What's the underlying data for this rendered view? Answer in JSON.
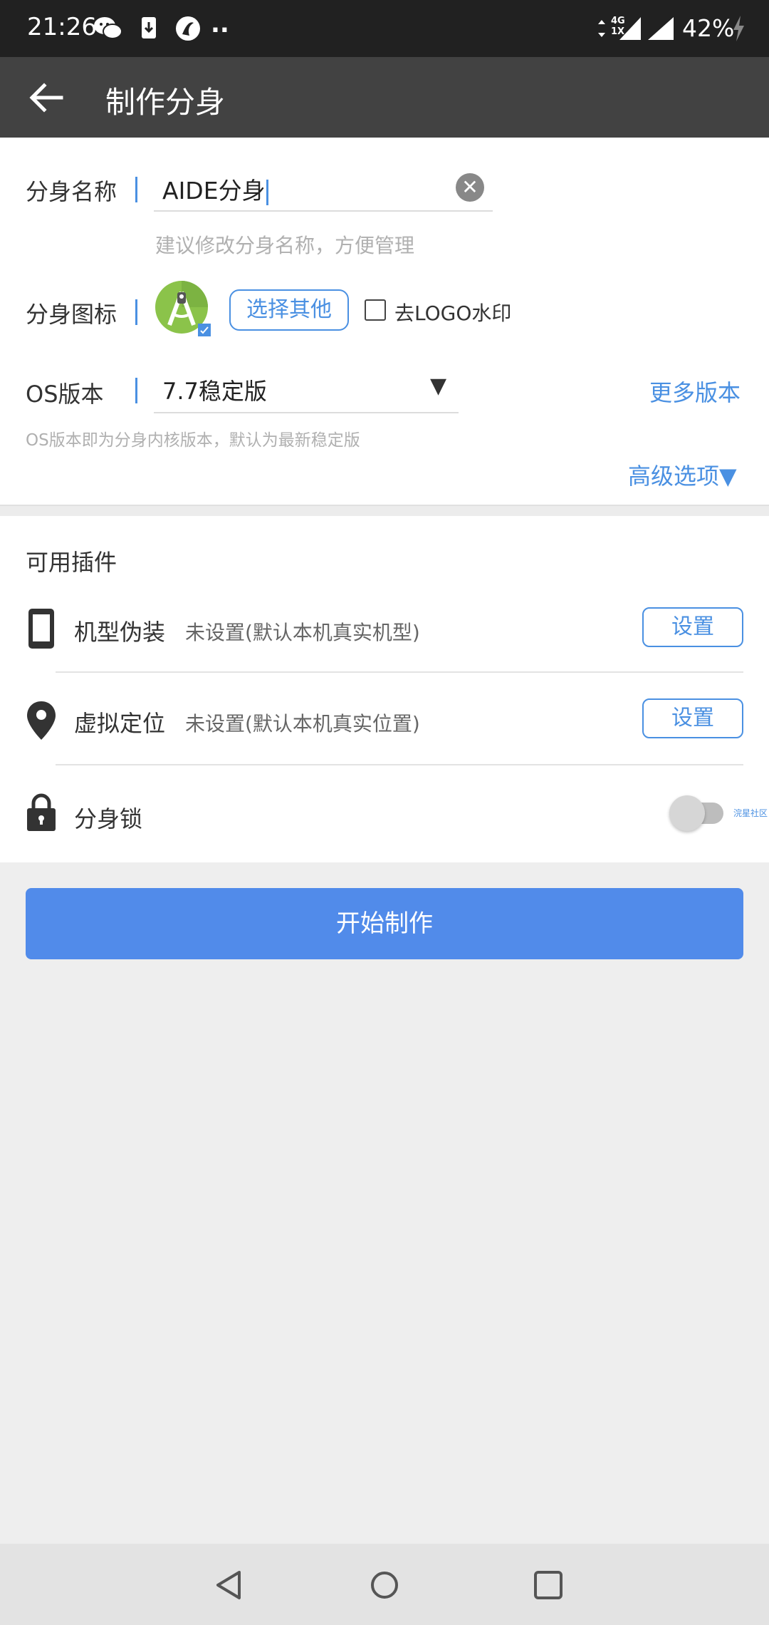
{
  "status_bar": {
    "time": "21:26",
    "battery": "42%",
    "more_indicator": "..",
    "network_top": "4G",
    "network_bottom": "1X"
  },
  "toolbar": {
    "title": "制作分身"
  },
  "form": {
    "name_label": "分身名称",
    "name_value": "AIDE分身",
    "name_hint": "建议修改分身名称，方便管理",
    "icon_label": "分身图标",
    "choose_other": "选择其他",
    "remove_logo": "去LOGO水印",
    "os_label": "OS版本",
    "os_value": "7.7稳定版",
    "more_versions": "更多版本",
    "os_hint": "OS版本即为分身内核版本，默认为最新稳定版",
    "advanced": "高级选项▼"
  },
  "plugins": {
    "title": "可用插件",
    "items": [
      {
        "name": "机型伪装",
        "desc": "未设置(默认本机真实机型)",
        "button": "设置",
        "icon": "phone-icon"
      },
      {
        "name": "虚拟定位",
        "desc": "未设置(默认本机真实位置)",
        "button": "设置",
        "icon": "location-pin-icon"
      },
      {
        "name": "分身锁",
        "icon": "lock-icon",
        "toggle_on": false
      }
    ],
    "watermark": "浣星社区"
  },
  "start_button": "开始制作",
  "colors": {
    "accent": "#4a90e2",
    "primary_button": "#518bea",
    "toolbar": "#424242",
    "status_bar": "#212121"
  }
}
